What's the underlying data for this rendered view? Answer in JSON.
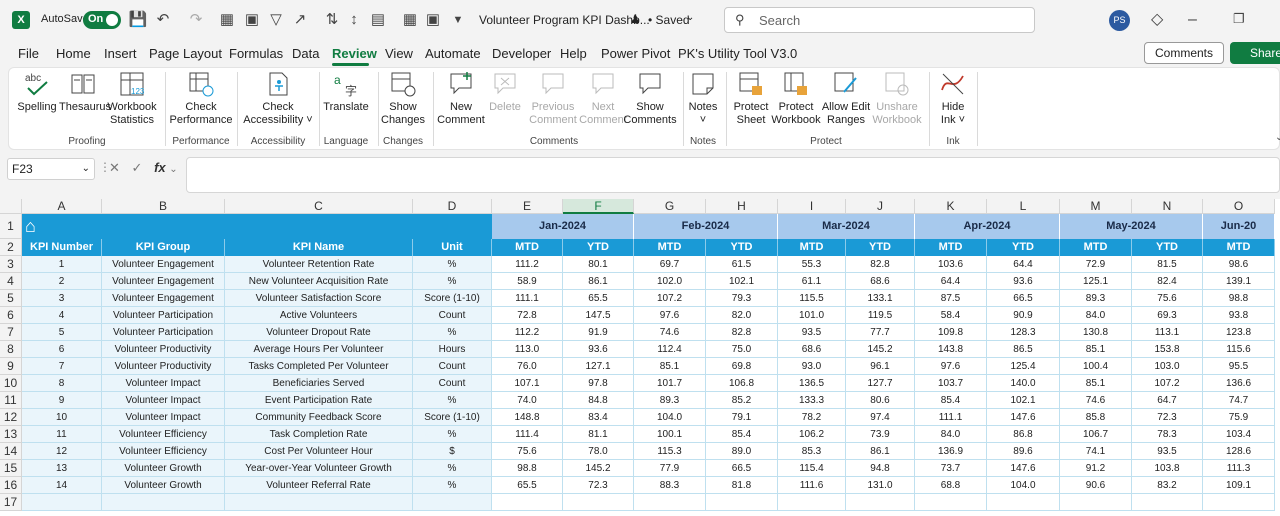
{
  "titlebar": {
    "autosave_label": "AutoSave",
    "toggle_state": "On",
    "doc_title": "Volunteer Program KPI Dashb...",
    "saved_status": "• Saved",
    "search_placeholder": "Search",
    "avatar_initials": "PS"
  },
  "tabs": [
    "File",
    "Home",
    "Insert",
    "Page Layout",
    "Formulas",
    "Data",
    "Review",
    "View",
    "Automate",
    "Developer",
    "Help",
    "Power Pivot",
    "PK's Utility Tool V3.0"
  ],
  "active_tab": "Review",
  "header_buttons": {
    "comments": "Comments",
    "share": "Share"
  },
  "ribbon": {
    "spelling": "Spelling",
    "thesaurus": "Thesaurus",
    "workbook_stats_1": "Workbook",
    "workbook_stats_2": "Statistics",
    "check_perf_1": "Check",
    "check_perf_2": "Performance",
    "check_acc_1": "Check",
    "check_acc_2": "Accessibility ˅",
    "translate": "Translate",
    "show_changes_1": "Show",
    "show_changes_2": "Changes",
    "new_comment_1": "New",
    "new_comment_2": "Comment",
    "delete": "Delete",
    "prev_comment_1": "Previous",
    "prev_comment_2": "Comment",
    "next_comment_1": "Next",
    "next_comment_2": "Comment",
    "show_comments_1": "Show",
    "show_comments_2": "Comments",
    "notes_1": "Notes",
    "notes_2": "˅",
    "protect_sheet_1": "Protect",
    "protect_sheet_2": "Sheet",
    "protect_wb_1": "Protect",
    "protect_wb_2": "Workbook",
    "allow_edit_1": "Allow Edit",
    "allow_edit_2": "Ranges",
    "unshare_1": "Unshare",
    "unshare_2": "Workbook",
    "hide_ink_1": "Hide",
    "hide_ink_2": "Ink ˅",
    "groups": {
      "proofing": "Proofing",
      "performance": "Performance",
      "accessibility": "Accessibility",
      "language": "Language",
      "changes": "Changes",
      "comments": "Comments",
      "notes": "Notes",
      "protect": "Protect",
      "ink": "Ink"
    }
  },
  "formula_bar": {
    "name_box": "F23",
    "fx": "fx",
    "formula": ""
  },
  "sheet": {
    "selected_column": "F",
    "columns": [
      "A",
      "B",
      "C",
      "D",
      "E",
      "F",
      "G",
      "H",
      "I",
      "J",
      "K",
      "L",
      "M",
      "N",
      "O"
    ],
    "row_numbers": [
      "1",
      "2",
      "3",
      "4",
      "5",
      "6",
      "7",
      "8",
      "9",
      "10",
      "11",
      "12",
      "13",
      "14",
      "15",
      "16",
      "17"
    ],
    "months": [
      "Jan-2024",
      "Feb-2024",
      "Mar-2024",
      "Apr-2024",
      "May-2024",
      "Jun-20"
    ],
    "headers": [
      "KPI Number",
      "KPI Group",
      "KPI Name",
      "Unit"
    ],
    "sub_headers": [
      "MTD",
      "YTD"
    ],
    "rows": [
      {
        "n": "1",
        "group": "Volunteer Engagement",
        "name": "Volunteer Retention Rate",
        "unit": "%",
        "vals": [
          "111.2",
          "80.1",
          "69.7",
          "61.5",
          "55.3",
          "82.8",
          "103.6",
          "64.4",
          "72.9",
          "81.5",
          "98.6"
        ]
      },
      {
        "n": "2",
        "group": "Volunteer Engagement",
        "name": "New Volunteer Acquisition Rate",
        "unit": "%",
        "vals": [
          "58.9",
          "86.1",
          "102.0",
          "102.1",
          "61.1",
          "68.6",
          "64.4",
          "93.6",
          "125.1",
          "82.4",
          "139.1"
        ]
      },
      {
        "n": "3",
        "group": "Volunteer Engagement",
        "name": "Volunteer Satisfaction Score",
        "unit": "Score (1-10)",
        "vals": [
          "111.1",
          "65.5",
          "107.2",
          "79.3",
          "115.5",
          "133.1",
          "87.5",
          "66.5",
          "89.3",
          "75.6",
          "98.8"
        ]
      },
      {
        "n": "4",
        "group": "Volunteer Participation",
        "name": "Active Volunteers",
        "unit": "Count",
        "vals": [
          "72.8",
          "147.5",
          "97.6",
          "82.0",
          "101.0",
          "119.5",
          "58.4",
          "90.9",
          "84.0",
          "69.3",
          "93.8"
        ]
      },
      {
        "n": "5",
        "group": "Volunteer Participation",
        "name": "Volunteer Dropout Rate",
        "unit": "%",
        "vals": [
          "112.2",
          "91.9",
          "74.6",
          "82.8",
          "93.5",
          "77.7",
          "109.8",
          "128.3",
          "130.8",
          "113.1",
          "123.8"
        ]
      },
      {
        "n": "6",
        "group": "Volunteer Productivity",
        "name": "Average Hours Per Volunteer",
        "unit": "Hours",
        "vals": [
          "113.0",
          "93.6",
          "112.4",
          "75.0",
          "68.6",
          "145.2",
          "143.8",
          "86.5",
          "85.1",
          "153.8",
          "115.6"
        ]
      },
      {
        "n": "7",
        "group": "Volunteer Productivity",
        "name": "Tasks Completed Per Volunteer",
        "unit": "Count",
        "vals": [
          "76.0",
          "127.1",
          "85.1",
          "69.8",
          "93.0",
          "96.1",
          "97.6",
          "125.4",
          "100.4",
          "103.0",
          "95.5"
        ]
      },
      {
        "n": "8",
        "group": "Volunteer Impact",
        "name": "Beneficiaries Served",
        "unit": "Count",
        "vals": [
          "107.1",
          "97.8",
          "101.7",
          "106.8",
          "136.5",
          "127.7",
          "103.7",
          "140.0",
          "85.1",
          "107.2",
          "136.6"
        ]
      },
      {
        "n": "9",
        "group": "Volunteer Impact",
        "name": "Event Participation Rate",
        "unit": "%",
        "vals": [
          "74.0",
          "84.8",
          "89.3",
          "85.2",
          "133.3",
          "80.6",
          "85.4",
          "102.1",
          "74.6",
          "64.7",
          "74.7"
        ]
      },
      {
        "n": "10",
        "group": "Volunteer Impact",
        "name": "Community Feedback Score",
        "unit": "Score (1-10)",
        "vals": [
          "148.8",
          "83.4",
          "104.0",
          "79.1",
          "78.2",
          "97.4",
          "111.1",
          "147.6",
          "85.8",
          "72.3",
          "75.9"
        ]
      },
      {
        "n": "11",
        "group": "Volunteer Efficiency",
        "name": "Task Completion Rate",
        "unit": "%",
        "vals": [
          "111.4",
          "81.1",
          "100.1",
          "85.4",
          "106.2",
          "73.9",
          "84.0",
          "86.8",
          "106.7",
          "78.3",
          "103.4"
        ]
      },
      {
        "n": "12",
        "group": "Volunteer Efficiency",
        "name": "Cost Per Volunteer Hour",
        "unit": "$",
        "vals": [
          "75.6",
          "78.0",
          "115.3",
          "89.0",
          "85.3",
          "86.1",
          "136.9",
          "89.6",
          "74.1",
          "93.5",
          "128.6"
        ]
      },
      {
        "n": "13",
        "group": "Volunteer Growth",
        "name": "Year-over-Year Volunteer Growth",
        "unit": "%",
        "vals": [
          "98.8",
          "145.2",
          "77.9",
          "66.5",
          "115.4",
          "94.8",
          "73.7",
          "147.6",
          "91.2",
          "103.8",
          "111.3"
        ]
      },
      {
        "n": "14",
        "group": "Volunteer Growth",
        "name": "Volunteer Referral Rate",
        "unit": "%",
        "vals": [
          "65.5",
          "72.3",
          "88.3",
          "81.8",
          "111.6",
          "131.0",
          "68.8",
          "104.0",
          "90.6",
          "83.2",
          "109.1"
        ]
      }
    ]
  },
  "colors": {
    "accent": "#107c41",
    "header_blue": "#1a9ad6",
    "month_blue": "#a7c9ed",
    "row_tint": "#eaf5fb"
  }
}
